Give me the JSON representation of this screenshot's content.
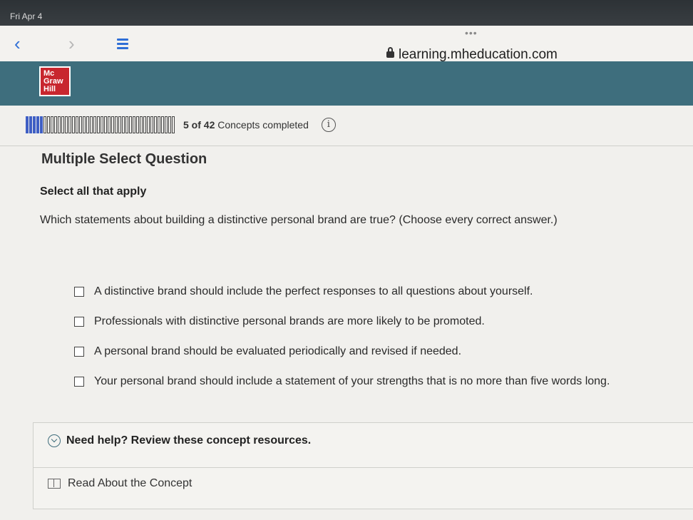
{
  "status_bar": {
    "date": "Fri Apr 4"
  },
  "browser": {
    "url": "learning.mheducation.com",
    "menu_dots": "•••",
    "back_icon": "chevron-left-icon",
    "forward_icon": "chevron-right-icon",
    "reader_icon": "reader-icon",
    "lock_icon": "lock-icon"
  },
  "header": {
    "logo_lines": [
      "Mc",
      "Graw",
      "Hill"
    ],
    "color": "#3e6e7d"
  },
  "progress": {
    "completed": 5,
    "total": 42,
    "count_label": "5 of 42",
    "suffix": "Concepts completed",
    "info_icon": "i"
  },
  "question": {
    "type": "Multiple Select Question",
    "instruction": "Select all that apply",
    "text": "Which statements about building a distinctive personal brand are true? (Choose every correct answer.)",
    "choices": [
      "A distinctive brand should include the perfect responses to all questions about yourself.",
      "Professionals with distinctive personal brands are more likely to be promoted.",
      "A personal brand should be evaluated periodically and revised if needed.",
      "Your personal brand should include a statement of your strengths that is no more than five words long."
    ]
  },
  "help": {
    "toggle_label": "Need help? Review these concept resources.",
    "resource_label": "Read About the Concept"
  },
  "colors": {
    "accent": "#3e6e7d",
    "progress_done": "#3f5fc4",
    "link": "#2f6fd6"
  }
}
